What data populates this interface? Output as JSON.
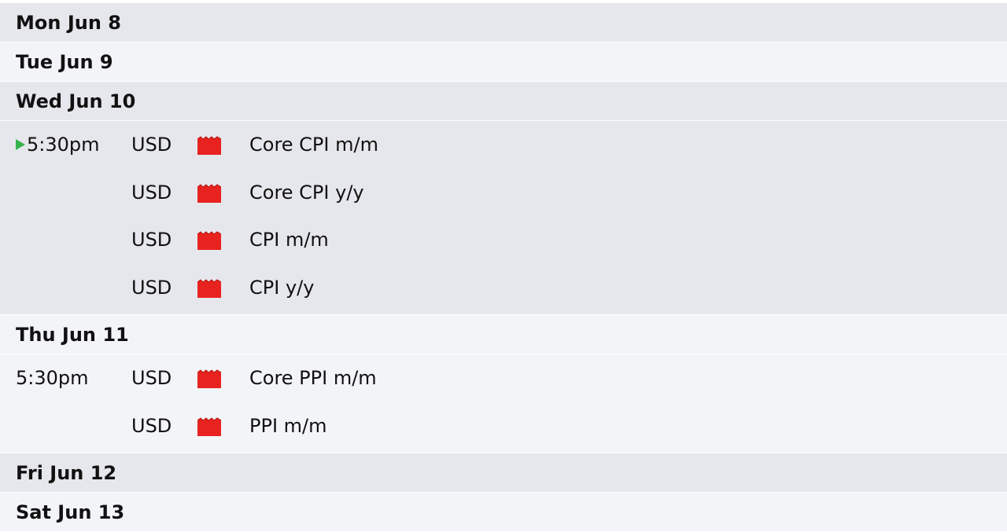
{
  "colors": {
    "row_shade_a": "#e6e7ec",
    "row_shade_b": "#f3f4f8",
    "high_impact": "#e8231f",
    "next_marker": "#37b24d"
  },
  "days": [
    {
      "label": "Mon Jun 8",
      "events": []
    },
    {
      "label": "Tue Jun 9",
      "events": []
    },
    {
      "label": "Wed Jun 10",
      "events": [
        {
          "time": "5:30pm",
          "next": true,
          "currency": "USD",
          "impact_icon": "high-impact-folder-icon",
          "title": "Core CPI m/m"
        },
        {
          "time": "",
          "currency": "USD",
          "impact_icon": "high-impact-folder-icon",
          "title": "Core CPI y/y"
        },
        {
          "time": "",
          "currency": "USD",
          "impact_icon": "high-impact-folder-icon",
          "title": "CPI m/m"
        },
        {
          "time": "",
          "currency": "USD",
          "impact_icon": "high-impact-folder-icon",
          "title": "CPI y/y"
        }
      ]
    },
    {
      "label": "Thu Jun 11",
      "events": [
        {
          "time": "5:30pm",
          "currency": "USD",
          "impact_icon": "high-impact-folder-icon",
          "title": "Core PPI m/m"
        },
        {
          "time": "",
          "currency": "USD",
          "impact_icon": "high-impact-folder-icon",
          "title": "PPI m/m"
        }
      ]
    },
    {
      "label": "Fri Jun 12",
      "events": []
    },
    {
      "label": "Sat Jun 13",
      "events": []
    }
  ]
}
